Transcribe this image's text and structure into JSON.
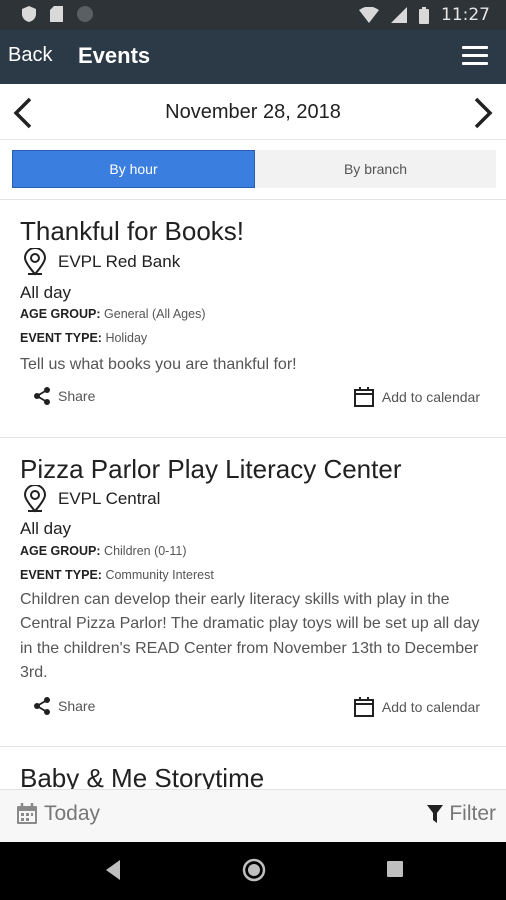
{
  "status_bar": {
    "time": "11:27"
  },
  "app_bar": {
    "back_label": "Back",
    "title": "Events"
  },
  "date_nav": {
    "date": "November 28, 2018"
  },
  "view_toggle": {
    "by_hour": "By hour",
    "by_branch": "By branch",
    "selected": "By hour"
  },
  "events": [
    {
      "title": "Thankful for Books!",
      "location": "EVPL Red Bank",
      "time": "All day",
      "age_group_label": "AGE GROUP:",
      "age_group": "General (All Ages)",
      "event_type_label": "EVENT TYPE:",
      "event_type": "Holiday",
      "description": "Tell us what books you are thankful for!",
      "share_label": "Share",
      "calendar_label": "Add to calendar"
    },
    {
      "title": "Pizza Parlor Play Literacy Center",
      "location": "EVPL Central",
      "time": "All day",
      "age_group_label": "AGE GROUP:",
      "age_group": "Children (0-11)",
      "event_type_label": "EVENT TYPE:",
      "event_type": "Community Interest",
      "description": "Children can develop their early literacy skills with play in the Central Pizza Parlor! The dramatic play toys will be set up all day in the children's READ Center from November 13th to December 3rd.",
      "share_label": "Share",
      "calendar_label": "Add to calendar"
    },
    {
      "title": "Baby & Me Storytime"
    }
  ],
  "bottom_bar": {
    "today_label": "Today",
    "filter_label": "Filter"
  },
  "colors": {
    "app_bar": "#2c3a47",
    "accent": "#3a7ee0",
    "status_bar": "#2e3338"
  }
}
